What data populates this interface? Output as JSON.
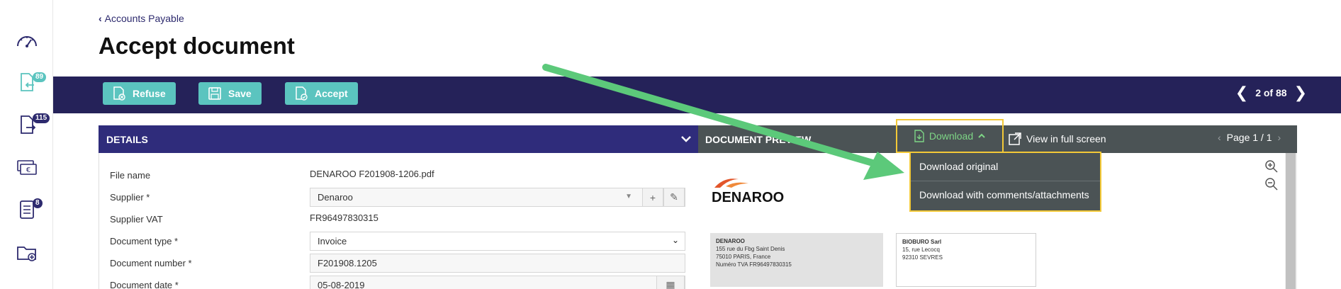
{
  "rail": {
    "items": [
      {
        "name": "dashboard",
        "icon": "speedometer-icon"
      },
      {
        "name": "incoming",
        "icon": "document-in-icon",
        "badge": "89"
      },
      {
        "name": "outgoing",
        "icon": "document-out-icon",
        "badge": "115"
      },
      {
        "name": "payments",
        "icon": "euro-bills-icon"
      },
      {
        "name": "lists",
        "icon": "checklist-icon",
        "badge": "8"
      },
      {
        "name": "folders",
        "icon": "folder-add-icon"
      }
    ]
  },
  "header": {
    "breadcrumb": "Accounts Payable",
    "title": "Accept document"
  },
  "toolbar": {
    "refuse_label": "Refuse",
    "save_label": "Save",
    "accept_label": "Accept",
    "pager": "2 of 88"
  },
  "details": {
    "title": "DETAILS",
    "fields": {
      "file_name_label": "File name",
      "file_name_value": "DENAROO F201908-1206.pdf",
      "supplier_label": "Supplier *",
      "supplier_value": "Denaroo",
      "supplier_vat_label": "Supplier VAT",
      "supplier_vat_value": "FR96497830315",
      "doc_type_label": "Document type *",
      "doc_type_value": "Invoice",
      "doc_number_label": "Document number *",
      "doc_number_value": "F201908.1205",
      "doc_date_label": "Document date *",
      "doc_date_value": "05-08-2019"
    }
  },
  "preview": {
    "title": "DOCUMENT PREVIEW",
    "download_label": "Download",
    "fullscreen_label": "View in full screen",
    "page_label": "Page 1 / 1",
    "dropdown": {
      "item1": "Download original",
      "item2": "Download with comments/attachments"
    },
    "doc": {
      "logo_text": "DENAROO",
      "sender": {
        "name": "DENAROO",
        "line1": "155 rue du Fbg Saint Denis",
        "line2": "75010 PARIS, France",
        "line3": "Numéro TVA FR96497830315"
      },
      "recipient": {
        "name": "BIOBURO Sarl",
        "line1": "15, rue Lecocq",
        "line2": "92310 SEVRES"
      }
    }
  },
  "colors": {
    "navy": "#252259",
    "details_header": "#2f2c7b",
    "teal": "#5bc4bf",
    "preview_header": "#4b5355",
    "highlight": "#f3c937",
    "arrow": "#5cc97a"
  }
}
